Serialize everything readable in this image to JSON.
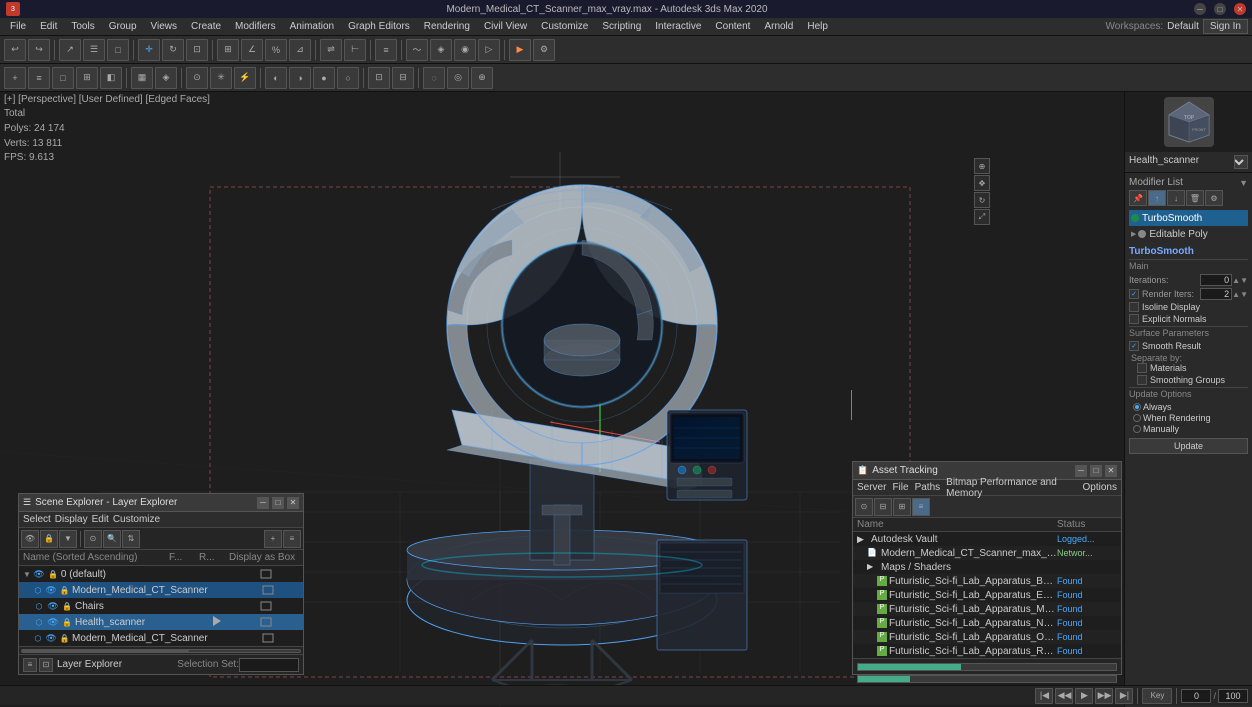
{
  "titlebar": {
    "title": "Modern_Medical_CT_Scanner_max_vray.max - Autodesk 3ds Max 2020",
    "controls": [
      "minimize",
      "maximize",
      "close"
    ]
  },
  "menubar": {
    "items": [
      "File",
      "Edit",
      "Tools",
      "Group",
      "Views",
      "Create",
      "Modifiers",
      "Animation",
      "Graph Editors",
      "Rendering",
      "Civil View",
      "Customize",
      "Scripting",
      "Interactive",
      "Content",
      "Arnold",
      "Help"
    ]
  },
  "toolbar": {
    "label": "toolbar"
  },
  "toolbar2": {
    "label": "toolbar2"
  },
  "workspace": {
    "label": "Workspaces:",
    "value": "Default"
  },
  "signin": {
    "label": "Sign In"
  },
  "viewport": {
    "label": "[+] [Perspective] [User Defined] [Edged Faces]",
    "stats": {
      "total": "Total",
      "polys_label": "Polys:",
      "polys_value": "24 174",
      "verts_label": "Verts:",
      "verts_value": "13 811"
    },
    "fps_label": "FPS:",
    "fps_value": "9.613"
  },
  "right_panel": {
    "object_name": "Health_scanner",
    "modifier_list_label": "Modifier List",
    "modifiers": [
      {
        "name": "TurboSmooth",
        "selected": true,
        "color": "#1e8a4a"
      },
      {
        "name": "Editable Poly",
        "selected": false,
        "color": "#888"
      }
    ],
    "turbosmooth": {
      "title": "TurboSmooth",
      "main_label": "Main",
      "iterations_label": "Iterations:",
      "iterations_value": "0",
      "render_iters_label": "Render Iters:",
      "render_iters_value": "2",
      "isoline_display": "Isoline Display",
      "explicit_normals": "Explicit Normals",
      "surface_params_label": "Surface Parameters",
      "smooth_result": "Smooth Result",
      "separate_by_label": "Separate by:",
      "materials_label": "Materials",
      "smoothing_groups_label": "Smoothing Groups",
      "update_options_label": "Update Options",
      "always_label": "Always",
      "when_rendering_label": "When Rendering",
      "manually_label": "Manually",
      "update_btn": "Update"
    }
  },
  "scene_explorer": {
    "title": "Scene Explorer - Layer Explorer",
    "menus": [
      "Select",
      "Display",
      "Edit",
      "Customize"
    ],
    "columns": {
      "name": "Name (Sorted Ascending)",
      "f": "F...",
      "r": "R...",
      "display": "Display as Box"
    },
    "items": [
      {
        "name": "0 (default)",
        "indent": 0,
        "hasArrow": true,
        "expanded": true,
        "type": "layer"
      },
      {
        "name": "Modern_Medical_CT_Scanner",
        "indent": 1,
        "hasArrow": false,
        "type": "object",
        "selected": true
      },
      {
        "name": "Chairs",
        "indent": 1,
        "hasArrow": false,
        "type": "object"
      },
      {
        "name": "Health_scanner",
        "indent": 1,
        "hasArrow": false,
        "type": "object",
        "highlighted": true
      },
      {
        "name": "Modern_Medical_CT_Scanner",
        "indent": 1,
        "hasArrow": false,
        "type": "object"
      }
    ],
    "footer": {
      "label": "Layer Explorer",
      "selection_set": "Selection Set:"
    }
  },
  "asset_tracking": {
    "title": "Asset Tracking",
    "menus": [
      "Server",
      "File",
      "Paths",
      "Bitmap Performance and Memory",
      "Options"
    ],
    "columns": {
      "name": "Name",
      "status": "Status"
    },
    "items": [
      {
        "name": "Autodesk Vault",
        "indent": 0,
        "type": "folder",
        "status": "Logged..."
      },
      {
        "name": "Modern_Medical_CT_Scanner_max_vray.max",
        "indent": 1,
        "type": "file",
        "status": "Networ..."
      },
      {
        "name": "Maps / Shaders",
        "indent": 1,
        "type": "folder",
        "status": ""
      },
      {
        "name": "Futuristic_Sci-fi_Lab_Apparatus_Base_Color.png",
        "indent": 2,
        "type": "image",
        "status": "Found"
      },
      {
        "name": "Futuristic_Sci-fi_Lab_Apparatus_Emissive.png",
        "indent": 2,
        "type": "image",
        "status": "Found"
      },
      {
        "name": "Futuristic_Sci-fi_Lab_Apparatus_Metallic.png",
        "indent": 2,
        "type": "image",
        "status": "Found"
      },
      {
        "name": "Futuristic_Sci-fi_Lab_Apparatus_Normal.png",
        "indent": 2,
        "type": "image",
        "status": "Found"
      },
      {
        "name": "Futuristic_Sci-fi_Lab_Apparatus_Opacity.png",
        "indent": 2,
        "type": "image",
        "status": "Found"
      },
      {
        "name": "Futuristic_Sci-fi_Lab_Apparatus_Roughness.png",
        "indent": 2,
        "type": "image",
        "status": "Found"
      }
    ]
  },
  "statusbar": {
    "text": ""
  }
}
